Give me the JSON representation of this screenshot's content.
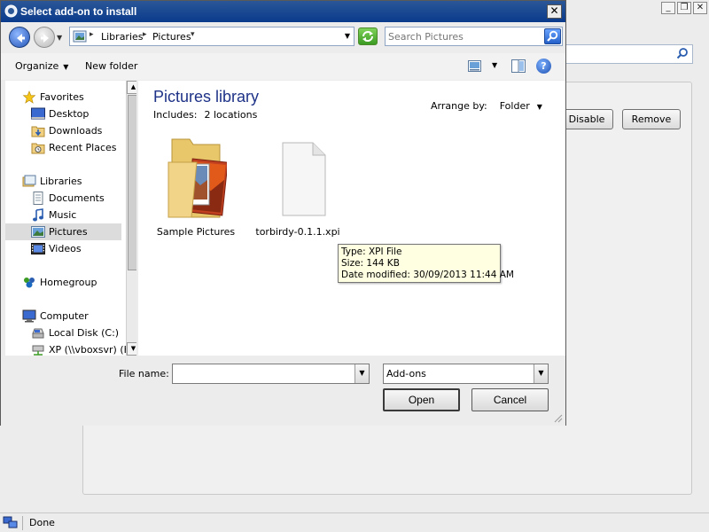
{
  "background": {
    "window_buttons": [
      "_",
      "❐",
      "✕"
    ],
    "disable_label": "Disable",
    "remove_label": "Remove",
    "status_text": "Done"
  },
  "dialog": {
    "title": "Select add-on to install",
    "close_label": "✕",
    "breadcrumbs": [
      "Libraries",
      "Pictures"
    ],
    "search_placeholder": "Search Pictures",
    "commands": {
      "organize": "Organize",
      "new_folder": "New folder",
      "help": "?"
    },
    "nav": {
      "favorites": "Favorites",
      "desktop": "Desktop",
      "downloads": "Downloads",
      "recent_places": "Recent Places",
      "libraries": "Libraries",
      "documents": "Documents",
      "music": "Music",
      "pictures": "Pictures",
      "videos": "Videos",
      "homegroup": "Homegroup",
      "computer": "Computer",
      "local_disk": "Local Disk (C:)",
      "network_drive": "XP (\\\\vboxsvr) (K"
    },
    "content": {
      "title": "Pictures library",
      "includes_label": "Includes:",
      "includes_value": "2 locations",
      "arrange_label": "Arrange by:",
      "arrange_value": "Folder",
      "items": [
        {
          "name": "Sample Pictures",
          "icon": "folder-pictures-icon"
        },
        {
          "name": "torbirdy-0.1.1.xpi",
          "icon": "file-icon"
        }
      ]
    },
    "tooltip": {
      "type": "Type: XPI File",
      "size": "Size: 144 KB",
      "modified": "Date modified: 30/09/2013 11:44 AM"
    },
    "file_name_label": "File name:",
    "file_name_value": "",
    "filter_value": "Add-ons",
    "open_label": "Open",
    "cancel_label": "Cancel"
  },
  "colors": {
    "titlebar": "#0a3a8c",
    "library_title": "#1e3287",
    "tooltip_bg": "#ffffe1",
    "selected_nav": "#dcdcdc"
  }
}
